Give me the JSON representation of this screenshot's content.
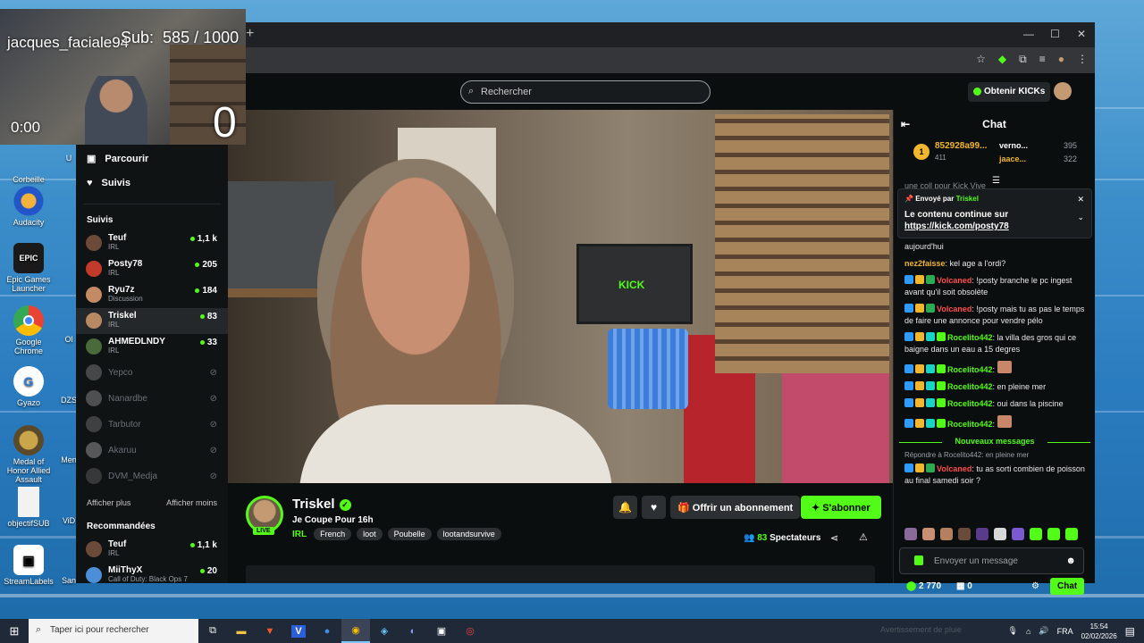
{
  "overlay": {
    "username": "jacques_faciale94",
    "sub_label": "Sub:",
    "sub_count": "585 / 1000",
    "timer": "0:00",
    "counter": "0"
  },
  "desktop": {
    "icons": [
      {
        "label": "Corbeille"
      },
      {
        "label": "Audacity"
      },
      {
        "label": "Epic Games Launcher"
      },
      {
        "label": "Google Chrome"
      },
      {
        "label": "Gyazo"
      },
      {
        "label": "Medal of Honor Allied Assault"
      },
      {
        "label": "objectifSUB"
      },
      {
        "label": "StreamLabels"
      }
    ],
    "partial_labels": [
      "U",
      "Ol",
      "DZS",
      "Men",
      "ViD",
      "San"
    ]
  },
  "browser": {
    "new_tab": "+",
    "minimize": "—",
    "maximize": "☐",
    "close": "✕"
  },
  "kick": {
    "search_placeholder": "Rechercher",
    "get_kicks": "Obtenir KICKs",
    "nav": {
      "browse": "Parcourir",
      "following": "Suivis"
    },
    "followed_header": "Suivis",
    "followed": [
      {
        "name": "Teuf",
        "cat": "IRL",
        "viewers": "1,1 k",
        "live": true,
        "color": "#6b4a3a"
      },
      {
        "name": "Posty78",
        "cat": "IRL",
        "viewers": "205",
        "live": true,
        "color": "#c23a2a"
      },
      {
        "name": "Ryu7z",
        "cat": "Discussion",
        "viewers": "184",
        "live": true,
        "color": "#c48a64"
      },
      {
        "name": "Triskel",
        "cat": "IRL",
        "viewers": "83",
        "live": true,
        "color": "#b88a64"
      },
      {
        "name": "AHMEDLNDY",
        "cat": "IRL",
        "viewers": "33",
        "live": true,
        "color": "#4a6a3a"
      },
      {
        "name": "Yepco",
        "cat": "",
        "viewers": "",
        "live": false,
        "color": "#888"
      },
      {
        "name": "Nanardbe",
        "cat": "",
        "viewers": "",
        "live": false,
        "color": "#999"
      },
      {
        "name": "Tarbutor",
        "cat": "",
        "viewers": "",
        "live": false,
        "color": "#777"
      },
      {
        "name": "Akaruu",
        "cat": "",
        "viewers": "",
        "live": false,
        "color": "#aaa"
      },
      {
        "name": "DVM_Medja",
        "cat": "",
        "viewers": "",
        "live": false,
        "color": "#666"
      }
    ],
    "show_more": "Afficher plus",
    "show_less": "Afficher moins",
    "recommended_header": "Recommandées",
    "recommended": [
      {
        "name": "Teuf",
        "cat": "IRL",
        "viewers": "1,1 k",
        "color": "#6b4a3a"
      },
      {
        "name": "MiiThyX",
        "cat": "Call of Duty: Black Ops 7",
        "viewers": "20",
        "color": "#4a8fd8"
      }
    ],
    "stream": {
      "channel": "Triskel",
      "title": "Je Coupe Pour 16h",
      "category": "IRL",
      "tags": [
        "French",
        "loot",
        "Poubelle",
        "lootandsurvive"
      ],
      "live_label": "LIVE",
      "offer_sub": "Offrir un abonnement",
      "subscribe": "S'abonner",
      "viewers": "83",
      "viewers_label": "Spectateurs",
      "video_text": "KICK"
    },
    "chat": {
      "title": "Chat",
      "leaderboard": {
        "first": {
          "name": "852928a99...",
          "score": "411",
          "rank": "1"
        },
        "second": {
          "name": "verno...",
          "value": "395"
        },
        "third": {
          "name": "jaace...",
          "value": "322"
        }
      },
      "partial_top": "une coll pour Kick Vive",
      "pinned": {
        "sent_by": "Envoyé par",
        "sender": "Triskel",
        "line1": "Le contenu continue sur",
        "link": "https://kick.com/posty78"
      },
      "messages": [
        {
          "user": "",
          "text": "aujourd'hui",
          "color": "#fff",
          "badges": []
        },
        {
          "user": "nez2faisse",
          "text": ": kel age a l'ordi?",
          "color": "#f0b72f",
          "badges": []
        },
        {
          "user": "Volcaned",
          "text": ": !posty branche le pc ingest avant qu'il soit obsolète",
          "color": "#ff4d4d",
          "badges": [
            "#2f9bff",
            "#f0b72f",
            "#2eaa52"
          ]
        },
        {
          "user": "Volcaned",
          "text": ": !posty mais tu as pas le temps de faire une annonce pour vendre pélo",
          "color": "#ff4d4d",
          "badges": [
            "#2f9bff",
            "#f0b72f",
            "#2eaa52"
          ]
        },
        {
          "user": "Rocelito442",
          "text": ": la villa des gros qui ce baigne dans un eau a 15 degres",
          "color": "#53fc18",
          "badges": [
            "#2f9bff",
            "#f0b72f",
            "#19d3c5",
            "#53fc18"
          ]
        },
        {
          "user": "Rocelito442",
          "text": ":",
          "color": "#53fc18",
          "badges": [
            "#2f9bff",
            "#f0b72f",
            "#19d3c5",
            "#53fc18"
          ]
        },
        {
          "user": "Rocelito442",
          "text": ": en pleine mer",
          "color": "#53fc18",
          "badges": [
            "#2f9bff",
            "#f0b72f",
            "#19d3c5",
            "#53fc18"
          ]
        },
        {
          "user": "Rocelito442",
          "text": ": oui dans la piscine",
          "color": "#53fc18",
          "badges": [
            "#2f9bff",
            "#f0b72f",
            "#19d3c5",
            "#53fc18"
          ]
        },
        {
          "user": "Rocelito442",
          "text": ":",
          "color": "#53fc18",
          "badges": [
            "#2f9bff",
            "#f0b72f",
            "#19d3c5",
            "#53fc18"
          ]
        }
      ],
      "new_messages": "Nouveaux messages",
      "reply_to": "Répondre à Rocelito442: en pleine mer",
      "last_message": {
        "user": "Volcaned",
        "text": ": tu as sorti combien de poisson au final samedi soir ?"
      },
      "input_placeholder": "Envoyer un message",
      "points": "2 770",
      "drops": "0",
      "chat_button": "Chat"
    }
  },
  "taskbar": {
    "search_placeholder": "Taper ici pour rechercher",
    "lang": "FRA",
    "time": "15:54",
    "date": "02/02/2026",
    "watermark": "Avertissement de pluie"
  }
}
